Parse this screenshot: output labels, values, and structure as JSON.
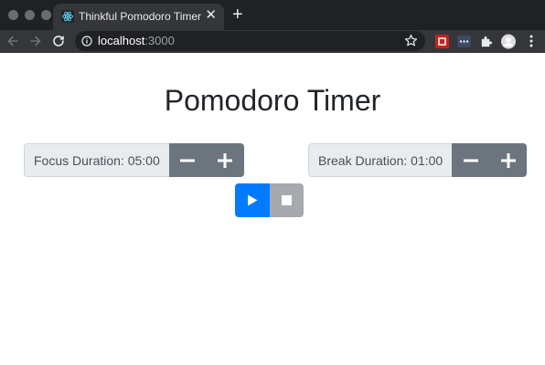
{
  "browser": {
    "tab": {
      "title": "Thinkful Pomodoro Timer",
      "close": "✕",
      "favicon": "react-logo"
    },
    "new_tab": "+",
    "url_host": "localhost",
    "url_port": ":3000"
  },
  "page": {
    "title": "Pomodoro Timer",
    "focus": {
      "label": "Focus Duration: 05:00",
      "decrease": "minus-icon",
      "increase": "plus-icon"
    },
    "break": {
      "label": "Break Duration: 01:00",
      "decrease": "minus-icon",
      "increase": "plus-icon"
    },
    "controls": {
      "play": "play-icon",
      "stop": "stop-icon"
    }
  },
  "colors": {
    "primary": "#007bff",
    "secondary": "#6c757d",
    "stop_disabled": "#a6a9ad",
    "label_bg": "#e9ecef",
    "browser_dark": "#202124",
    "browser_toolbar": "#35363a"
  }
}
